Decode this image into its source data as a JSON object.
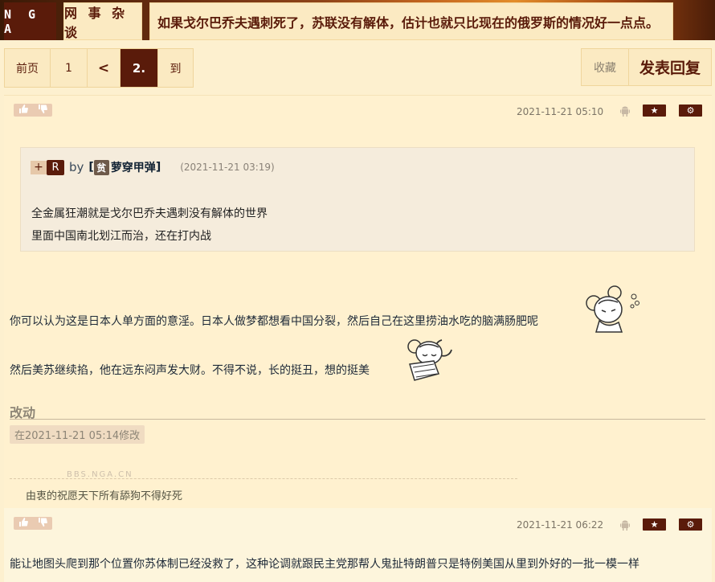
{
  "header": {
    "logo": "N G A",
    "forum": "网 事 杂 谈",
    "topic_title": "如果戈尔巴乔夫遇刺死了，苏联没有解体，估计也就只比现在的俄罗斯的情况好一点点。"
  },
  "pager": {
    "first": "前页",
    "page1": "1",
    "prev": "<",
    "current": "2.",
    "goto": "到"
  },
  "actions": {
    "favorite": "收藏",
    "reply": "发表回复"
  },
  "post1": {
    "date": "2021-11-21 05:10",
    "quote": {
      "plus": "+",
      "r": "R",
      "by": "by",
      "bracket_open": "[",
      "avatar_char": "贫",
      "author": "萝穿甲弹",
      "bracket_close": "]",
      "date": "(2021-11-21 03:19)",
      "lines": [
        "全金属狂潮就是戈尔巴乔夫遇刺没有解体的世界",
        "里面中国南北划江而治，还在打内战"
      ]
    },
    "lines": [
      "你可以认为这是日本人单方面的意淫。日本人做梦都想看中国分裂，然后自己在这里捞油水吃的脑满肠肥呢",
      "然后美苏继续掐，他在远东闷声发大财。不得不说，长的挺丑，想的挺美"
    ],
    "edit_heading": "改动",
    "edit_note": "在2021-11-21 05:14修改",
    "watermark": "BBS.NGA.CN",
    "signature": "由衷的祝愿天下所有舔狗不得好死"
  },
  "post2": {
    "date": "2021-11-21 06:22",
    "line": "能让地图头爬到那个位置你苏体制已经没救了，这种论调就跟民主党那帮人鬼扯特朗普只是特例美国从里到外好的一批一模一样"
  },
  "icons": {
    "thumb_up": "thumb-up-icon",
    "thumb_down": "thumb-down-icon",
    "android": "android-icon",
    "star": "star-icon",
    "gear": "gear-icon"
  }
}
